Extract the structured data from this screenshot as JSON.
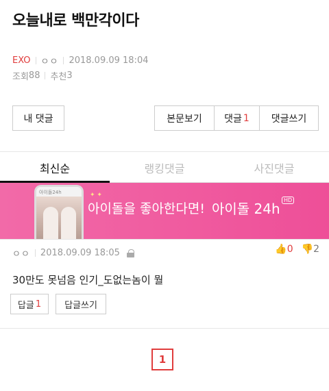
{
  "post": {
    "title": "오늘내로 백만각이다",
    "board": "EXO",
    "author": "ㅇㅇ",
    "datetime": "2018.09.09 18:04",
    "views_label": "조회",
    "views": "88",
    "likes_label": "추천",
    "likes": "3"
  },
  "actions": {
    "my_replies": "내 댓글",
    "view_body": "본문보기",
    "replies_label": "댓글",
    "replies_count": "1",
    "write_reply": "댓글쓰기"
  },
  "tabs": [
    "최신순",
    "랭킹댓글",
    "사진댓글"
  ],
  "banner": {
    "text": "아이돌을 좋아한다면!",
    "brand": "아이돌 24h",
    "badge": "HD",
    "phone_brand": "아이돌24h"
  },
  "comment": {
    "author": "ㅇㅇ",
    "datetime": "2018.09.09 18:05",
    "upvotes": "0",
    "downvotes": "2",
    "text": "30만도 못넘음 인기_도없는놈이 뭘",
    "reply_label": "답글",
    "reply_count": "1",
    "write_reply": "답글쓰기"
  },
  "pagination": {
    "current": "1"
  },
  "colors": {
    "accent": "#e03c3c",
    "banner": "#f05aa0"
  }
}
